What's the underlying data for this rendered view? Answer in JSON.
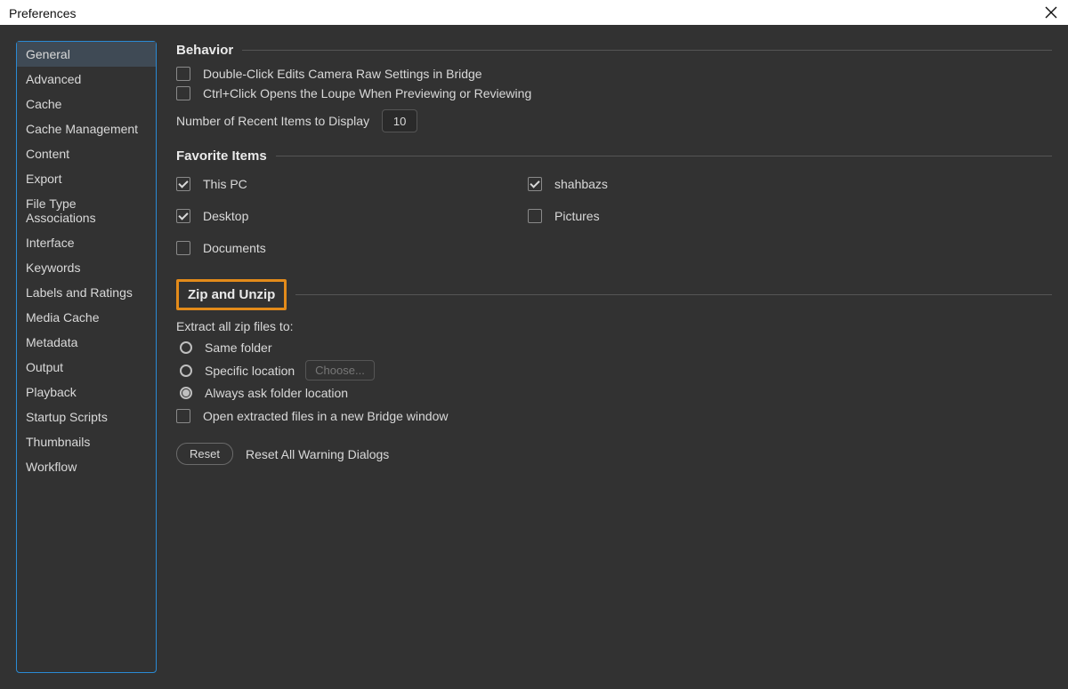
{
  "window": {
    "title": "Preferences"
  },
  "sidebar": {
    "items": [
      "General",
      "Advanced",
      "Cache",
      "Cache Management",
      "Content",
      "Export",
      "File Type Associations",
      "Interface",
      "Keywords",
      "Labels and Ratings",
      "Media Cache",
      "Metadata",
      "Output",
      "Playback",
      "Startup Scripts",
      "Thumbnails",
      "Workflow"
    ],
    "selected_index": 0
  },
  "behavior": {
    "title": "Behavior",
    "doubleclick_label": "Double-Click Edits Camera Raw Settings in Bridge",
    "doubleclick_checked": false,
    "ctrlclick_label": "Ctrl+Click Opens the Loupe When Previewing or Reviewing",
    "ctrlclick_checked": false,
    "recent_label": "Number of Recent Items to Display",
    "recent_value": "10"
  },
  "favorites": {
    "title": "Favorite Items",
    "items": [
      {
        "label": "This PC",
        "checked": true
      },
      {
        "label": "shahbazs",
        "checked": true
      },
      {
        "label": "Desktop",
        "checked": true
      },
      {
        "label": "Pictures",
        "checked": false
      },
      {
        "label": "Documents",
        "checked": false
      }
    ]
  },
  "zip": {
    "title": "Zip and Unzip",
    "prompt": "Extract all zip files to:",
    "same_label": "Same folder",
    "specific_label": "Specific location",
    "choose_label": "Choose...",
    "always_label": "Always ask folder location",
    "selected": "always",
    "open_new_window_label": "Open extracted files in a new Bridge window",
    "open_new_window_checked": false
  },
  "buttons": {
    "reset": "Reset",
    "reset_all": "Reset All Warning Dialogs"
  }
}
